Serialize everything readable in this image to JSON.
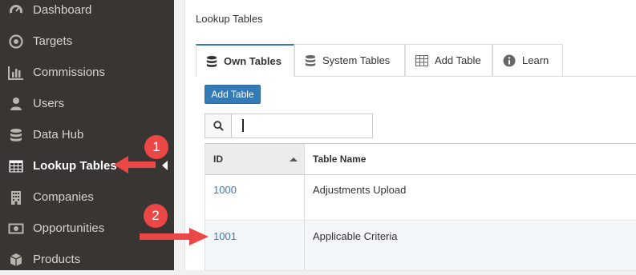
{
  "sidebar": {
    "items": [
      {
        "label": "Dashboard",
        "icon": "dashboard-icon"
      },
      {
        "label": "Targets",
        "icon": "target-icon"
      },
      {
        "label": "Commissions",
        "icon": "bar-chart-icon"
      },
      {
        "label": "Users",
        "icon": "user-icon"
      },
      {
        "label": "Data Hub",
        "icon": "database-icon"
      },
      {
        "label": "Lookup Tables",
        "icon": "table-icon"
      },
      {
        "label": "Companies",
        "icon": "building-icon"
      },
      {
        "label": "Opportunities",
        "icon": "money-icon"
      },
      {
        "label": "Products",
        "icon": "cube-icon"
      }
    ],
    "active": "Lookup Tables"
  },
  "panel": {
    "title": "Lookup Tables",
    "tabs": [
      {
        "label": "Own Tables",
        "icon": "database-icon"
      },
      {
        "label": "System Tables",
        "icon": "database-icon"
      },
      {
        "label": "Add Table",
        "icon": "table-icon"
      },
      {
        "label": "Learn",
        "icon": "info-icon"
      }
    ],
    "add_button": "Add Table",
    "search": {
      "value": "",
      "placeholder": ""
    },
    "table": {
      "columns": [
        "ID",
        "Table Name"
      ],
      "rows": [
        {
          "id": "1000",
          "name": "Adjustments Upload"
        },
        {
          "id": "1001",
          "name": "Applicable Criteria"
        }
      ]
    }
  },
  "annotations": {
    "markers": [
      "1",
      "2"
    ],
    "color": "#ec4747"
  },
  "colors": {
    "sidebar_bg": "#393532",
    "accent": "#3a79b8",
    "annotation": "#ec4747"
  }
}
